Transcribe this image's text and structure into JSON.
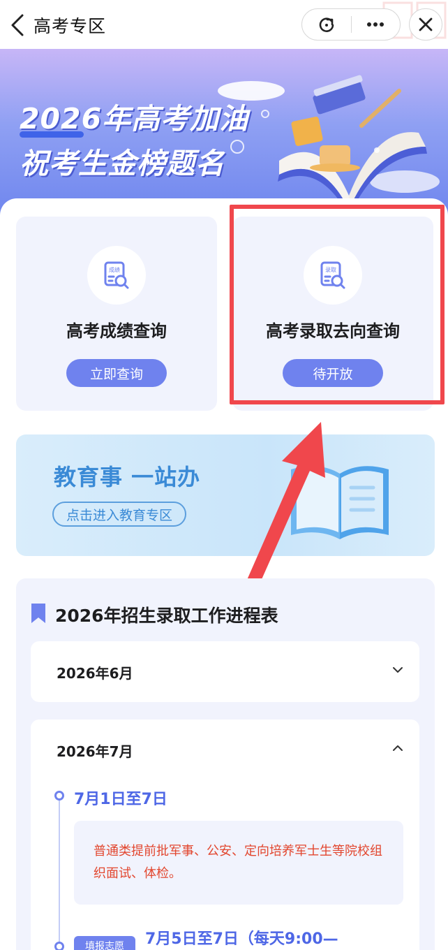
{
  "header": {
    "title": "高考专区",
    "refresh_icon": "refresh-icon",
    "more_icon": "more-icon",
    "close_icon": "close-icon",
    "back_icon": "chevron-left-icon"
  },
  "banner": {
    "line1": "2026年高考加油",
    "line2": "祝考生金榜题名"
  },
  "query_cards": [
    {
      "title": "高考成绩查询",
      "icon_label": "成绩",
      "button": "立即查询"
    },
    {
      "title": "高考录取去向查询",
      "icon_label": "录取",
      "button": "待开放"
    }
  ],
  "edu_banner": {
    "title": "教育事 一站办",
    "button": "点击进入教育专区"
  },
  "schedule": {
    "title": "2026年招生录取工作进程表",
    "months": [
      {
        "label": "2026年6月",
        "expanded": false
      },
      {
        "label": "2026年7月",
        "expanded": true
      }
    ],
    "july_items": [
      {
        "date": "7月1日至7日",
        "text": "普通类提前批军事、公安、定向培养军士生等院校组织面试、体检。"
      },
      {
        "tag": "填报志愿",
        "date": "7月5日至7日（每天9:00—"
      }
    ]
  },
  "colors": {
    "accent": "#6f82ee",
    "highlight_red": "#f0474c",
    "schedule_text": "#e2462e",
    "date_blue": "#4e67e6"
  }
}
